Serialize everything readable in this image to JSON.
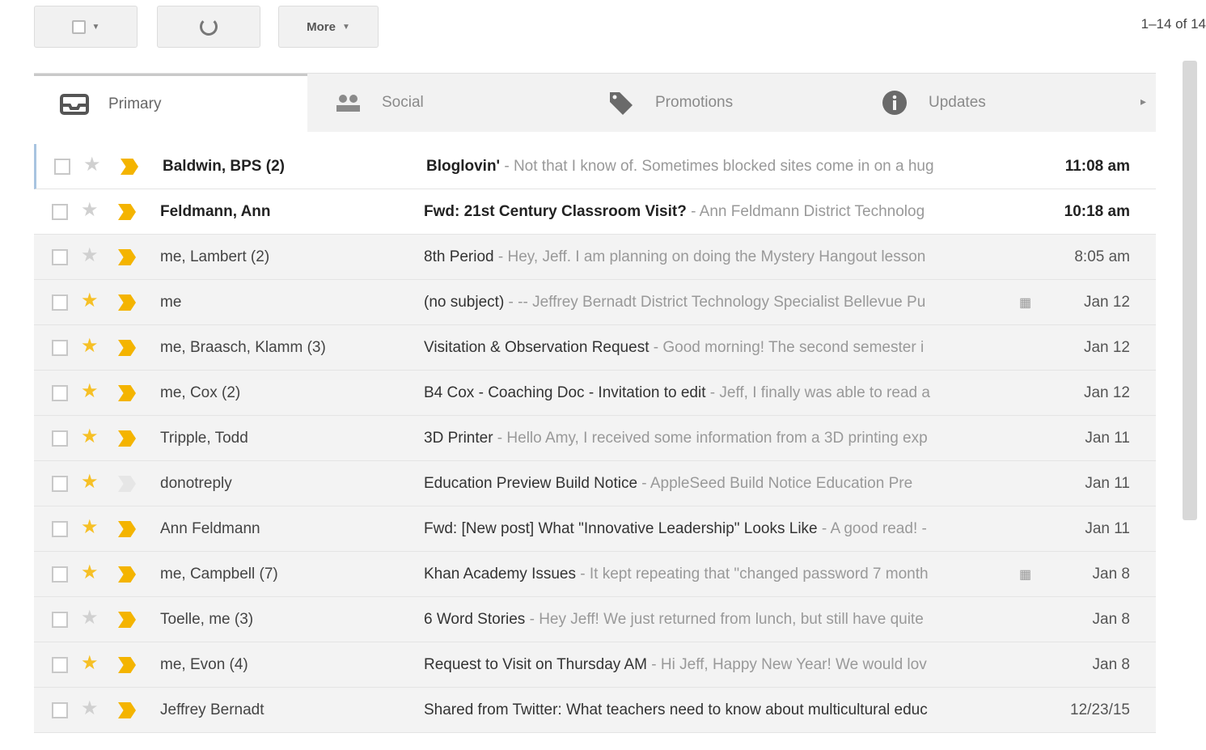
{
  "toolbar": {
    "more_label": "More",
    "pager": "1–14 of 14"
  },
  "tabs": [
    {
      "label": "Primary",
      "icon": "inbox-icon",
      "active": true
    },
    {
      "label": "Social",
      "icon": "people-icon",
      "active": false
    },
    {
      "label": "Promotions",
      "icon": "tag-icon",
      "active": false
    },
    {
      "label": "Updates",
      "icon": "info-icon",
      "active": false
    }
  ],
  "colors": {
    "star": "#f6c026",
    "important": "#f4b400",
    "selected_bar": "#a8c4e0"
  },
  "emails": [
    {
      "from": "Baldwin, BPS (2)",
      "subject": "Bloglovin'",
      "snippet": " - Not that I know of. Sometimes blocked sites come in on a hug",
      "date": "11:08 am",
      "unread": true,
      "starred": false,
      "important": true,
      "attachment": false
    },
    {
      "from": "Feldmann, Ann",
      "subject": "Fwd: 21st Century Classroom Visit?",
      "snippet": " - Ann Feldmann District Technolog",
      "date": "10:18 am",
      "unread": true,
      "starred": false,
      "important": true,
      "attachment": false
    },
    {
      "from": "me, Lambert (2)",
      "subject": "8th Period",
      "snippet": " - Hey, Jeff. I am planning on doing the Mystery Hangout lesson",
      "date": "8:05 am",
      "unread": false,
      "starred": false,
      "important": true,
      "attachment": false
    },
    {
      "from": "me",
      "subject": "(no subject)",
      "snippet": " - -- Jeffrey Bernadt District Technology Specialist Bellevue Pu",
      "date": "Jan 12",
      "unread": false,
      "starred": true,
      "important": true,
      "attachment": true
    },
    {
      "from": "me, Braasch, Klamm (3)",
      "subject": "Visitation & Observation Request",
      "snippet": " - Good morning! The second semester i",
      "date": "Jan 12",
      "unread": false,
      "starred": true,
      "important": true,
      "attachment": false
    },
    {
      "from": "me, Cox (2)",
      "subject": "B4 Cox - Coaching Doc - Invitation to edit",
      "snippet": " - Jeff, I finally was able to read a",
      "date": "Jan 12",
      "unread": false,
      "starred": true,
      "important": true,
      "attachment": false
    },
    {
      "from": "Tripple, Todd",
      "subject": "3D Printer",
      "snippet": " - Hello Amy, I received some information from a 3D printing exp",
      "date": "Jan 11",
      "unread": false,
      "starred": true,
      "important": true,
      "attachment": false
    },
    {
      "from": "donotreply",
      "subject": "Education Preview Build Notice",
      "snippet": " - AppleSeed Build Notice Education Pre",
      "date": "Jan 11",
      "unread": false,
      "starred": true,
      "important": false,
      "attachment": false
    },
    {
      "from": "Ann Feldmann",
      "subject": "Fwd: [New post] What \"Innovative Leadership\" Looks Like",
      "snippet": " - A good read! -",
      "date": "Jan 11",
      "unread": false,
      "starred": true,
      "important": true,
      "attachment": false
    },
    {
      "from": "me, Campbell (7)",
      "subject": "Khan Academy Issues",
      "snippet": " - It kept repeating that \"changed password 7 month",
      "date": "Jan 8",
      "unread": false,
      "starred": true,
      "important": true,
      "attachment": true
    },
    {
      "from": "Toelle, me (3)",
      "subject": "6 Word Stories",
      "snippet": " - Hey Jeff! We just returned from lunch, but still have quite",
      "date": "Jan 8",
      "unread": false,
      "starred": false,
      "important": true,
      "attachment": false
    },
    {
      "from": "me, Evon (4)",
      "subject": "Request to Visit on Thursday AM",
      "snippet": " - Hi Jeff, Happy New Year! We would lov",
      "date": "Jan 8",
      "unread": false,
      "starred": true,
      "important": true,
      "attachment": false
    },
    {
      "from": "Jeffrey Bernadt",
      "subject": "Shared from Twitter: What teachers need to know about multicultural educ",
      "snippet": "",
      "date": "12/23/15",
      "unread": false,
      "starred": false,
      "important": true,
      "attachment": false
    }
  ]
}
